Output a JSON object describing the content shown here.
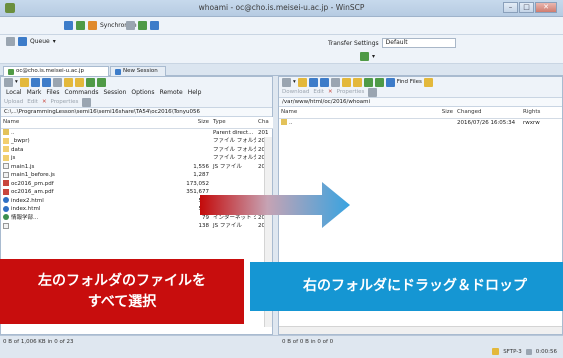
{
  "window": {
    "title": "whoami - oc@cho.is.meisei-u.ac.jp - WinSCP",
    "min_label": "–",
    "max_label": "□",
    "close_label": "✕"
  },
  "toolbar": {
    "synchronize_label": "Synchronize",
    "queue_label": "Queue",
    "transfer_settings_label": "Transfer Settings",
    "transfer_settings_value": "Default"
  },
  "tabs": [
    {
      "label": "oc@cho.is.meisei-u.ac.jp"
    },
    {
      "label": "New Session"
    }
  ],
  "left_panel": {
    "menu": [
      "Local",
      "Mark",
      "Files",
      "Commands",
      "Session",
      "Options",
      "Remote",
      "Help"
    ],
    "actions": [
      "Upload",
      "Edit",
      "Properties"
    ],
    "path": "C:\\...\\ProgrammingLesson\\semi16\\semi16share\\TA54\\oc2016\\Tonyu056",
    "columns": [
      "Name",
      "Size",
      "Type",
      "Cha"
    ],
    "rows": [
      {
        "icon": "up",
        "name": "..",
        "size": "",
        "type": "Parent direct...",
        "changed": "201"
      },
      {
        "icon": "folder",
        "name": "_bwpr)",
        "size": "",
        "type": "ファイル フォルダー",
        "changed": "201"
      },
      {
        "icon": "folder",
        "name": "data",
        "size": "",
        "type": "ファイル フォルダー",
        "changed": "201"
      },
      {
        "icon": "folder",
        "name": "js",
        "size": "",
        "type": "ファイル フォルダー",
        "changed": "201"
      },
      {
        "icon": "js",
        "name": "main1.js",
        "size": "1,556",
        "type": "JS ファイル",
        "changed": "201"
      },
      {
        "icon": "js",
        "name": "main1_before.js",
        "size": "1,287",
        "type": "",
        "changed": ""
      },
      {
        "icon": "pdf",
        "name": "oc2016_pm.pdf",
        "size": "173,052",
        "type": "",
        "changed": ""
      },
      {
        "icon": "pdf",
        "name": "oc2016_am.pdf",
        "size": "351,677",
        "type": "",
        "changed": ""
      },
      {
        "icon": "html",
        "name": "index2.html",
        "size": "557",
        "type": "Chrome HT...",
        "changed": "201"
      },
      {
        "icon": "html",
        "name": "index.html",
        "size": "568",
        "type": "Chrome HT...",
        "changed": "201"
      },
      {
        "icon": "web",
        "name": "情報学部...",
        "size": "79",
        "type": "インターネット シ...",
        "changed": "201"
      },
      {
        "icon": "js",
        "name": "",
        "size": "138",
        "type": "JS ファイル",
        "changed": "201"
      }
    ]
  },
  "right_panel": {
    "find_files_label": "Find Files",
    "actions": [
      "Download",
      "Edit",
      "Properties"
    ],
    "path": "/var/www/html/oc/2016/whoami",
    "columns": [
      "Name",
      "Size",
      "Changed",
      "Rights"
    ],
    "rows": [
      {
        "icon": "up",
        "name": "..",
        "size": "",
        "changed": "2016/07/26 16:05:34",
        "rights": "rwxrw"
      }
    ]
  },
  "status": {
    "left_selection": "0 B of 1,006 KB in 0 of 23",
    "right_selection": "0 B of 0 B in 0 of 0",
    "protocol": "SFTP-3",
    "elapsed": "0:00:56"
  },
  "annotations": {
    "left_line1": "左のフォルダのファイルを",
    "left_line2": "すべて選択",
    "right": "右のフォルダにドラッグ＆ドロップ",
    "left_color": "#c80d0d",
    "right_color": "#1596d3"
  }
}
